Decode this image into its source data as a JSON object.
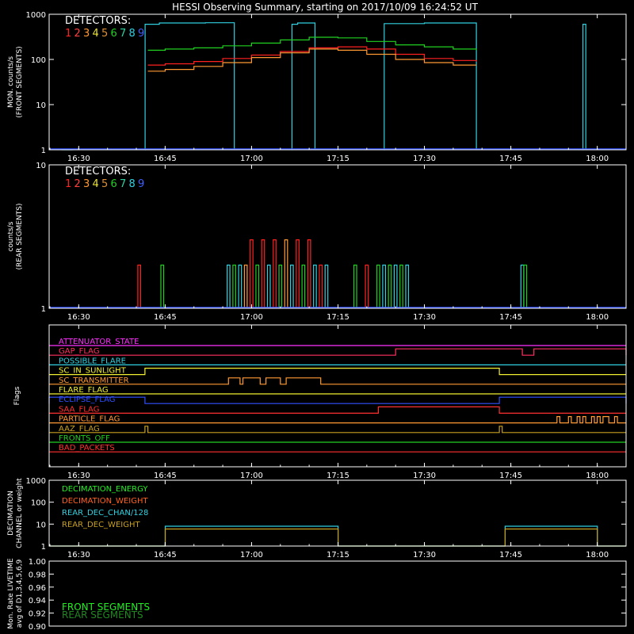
{
  "title": "HESSI Observing Summary, starting on 2017/10/09 16:24:52 UT",
  "colors": {
    "background": "#000000",
    "axis": "#ffffff",
    "det": [
      "#ff2020",
      "#ff4040",
      "#ff9933",
      "#e8e030",
      "#e09030",
      "#20d020",
      "#30d0a0",
      "#30d0e0",
      "#4060ff"
    ],
    "front": "#20ee20",
    "rear": "#208820"
  },
  "chart_data": [
    {
      "type": "line",
      "panel": "front",
      "ylabel": [
        "MON. counts/s",
        "(FRONT SEGMENTS)"
      ],
      "yscale": "log",
      "ylim": [
        1,
        1000
      ],
      "ytick_labels": [
        "1000",
        "100",
        "10",
        "1"
      ],
      "ytick_values": [
        1000,
        100,
        10,
        1
      ],
      "xlim": [
        "16:24:52",
        "18:05:00"
      ],
      "xtick_labels": [
        "16:30",
        "16:45",
        "17:00",
        "17:15",
        "17:30",
        "17:45",
        "18:00"
      ],
      "legend_title": "DETECTORS:",
      "legend_items": [
        "1",
        "2",
        "3",
        "4",
        "5",
        "6",
        "7",
        "8",
        "9"
      ],
      "series": [
        {
          "color": "#30d0e0",
          "segments": [
            {
              "x": [
                "16:27:00",
                "16:28:30",
                "16:29:00",
                "16:29:01"
              ],
              "y": [
                1,
                1,
                1,
                1
              ]
            },
            {
              "x": [
                "16:41:30",
                "16:41:31",
                "16:44:00",
                "16:52:00",
                "16:56:00",
                "16:57:00",
                "16:57:01"
              ],
              "y": [
                1,
                600,
                640,
                650,
                650,
                650,
                1
              ]
            },
            {
              "x": [
                "17:07:00",
                "17:07:01",
                "17:08:00",
                "17:11:00",
                "17:11:01"
              ],
              "y": [
                1,
                600,
                640,
                640,
                1
              ]
            },
            {
              "x": [
                "17:23:00",
                "17:23:01",
                "17:30:00",
                "17:35:00",
                "17:39:00",
                "17:39:01"
              ],
              "y": [
                1,
                620,
                640,
                640,
                640,
                1
              ]
            },
            {
              "x": [
                "17:57:30",
                "17:57:31",
                "17:58:00",
                "17:58:01"
              ],
              "y": [
                1,
                600,
                600,
                1
              ]
            }
          ]
        },
        {
          "color": "#20d020",
          "segments": [
            {
              "x": [
                "16:42:00",
                "16:45:00",
                "16:50:00",
                "16:55:00",
                "17:00:00",
                "17:05:00",
                "17:10:00",
                "17:15:00",
                "17:20:00",
                "17:25:00",
                "17:30:00",
                "17:35:00",
                "17:39:00"
              ],
              "y": [
                160,
                170,
                180,
                200,
                230,
                270,
                310,
                300,
                250,
                210,
                190,
                170,
                160
              ]
            }
          ]
        },
        {
          "color": "#ff2020",
          "segments": [
            {
              "x": [
                "16:42:00",
                "16:45:00",
                "16:50:00",
                "16:55:00",
                "17:00:00",
                "17:05:00",
                "17:10:00",
                "17:15:00",
                "17:20:00",
                "17:25:00",
                "17:30:00",
                "17:35:00",
                "17:39:00"
              ],
              "y": [
                75,
                80,
                90,
                105,
                125,
                150,
                180,
                190,
                170,
                130,
                105,
                95,
                90
              ]
            }
          ]
        },
        {
          "color": "#ff9933",
          "segments": [
            {
              "x": [
                "16:42:00",
                "16:45:00",
                "16:50:00",
                "16:55:00",
                "17:00:00",
                "17:05:00",
                "17:10:00",
                "17:15:00",
                "17:20:00",
                "17:25:00",
                "17:30:00",
                "17:35:00",
                "17:39:00"
              ],
              "y": [
                55,
                60,
                70,
                85,
                110,
                140,
                170,
                160,
                130,
                100,
                85,
                75,
                75
              ]
            }
          ]
        }
      ]
    },
    {
      "type": "line",
      "panel": "rear",
      "ylabel": [
        "counts/s",
        "(REAR SEGMENTS)"
      ],
      "yscale": "log",
      "ylim": [
        1,
        10
      ],
      "ytick_labels": [
        "10",
        "1"
      ],
      "ytick_values": [
        10,
        1
      ],
      "xtick_labels": [
        "16:30",
        "16:45",
        "17:00",
        "17:15",
        "17:30",
        "17:45",
        "18:00"
      ],
      "legend_title": "DETECTORS:",
      "legend_items": [
        "1",
        "2",
        "3",
        "4",
        "5",
        "6",
        "7",
        "8",
        "9"
      ],
      "spikes": [
        {
          "x": "16:40:30",
          "y": 2,
          "color": "#ff2020"
        },
        {
          "x": "16:44:30",
          "y": 2,
          "color": "#20d020"
        },
        {
          "x": "16:56:00",
          "y": 2,
          "color": "#30d0e0"
        },
        {
          "x": "16:57:00",
          "y": 2,
          "color": "#20d020"
        },
        {
          "x": "16:58:00",
          "y": 2,
          "color": "#30d0e0"
        },
        {
          "x": "16:59:00",
          "y": 2,
          "color": "#ff9933"
        },
        {
          "x": "17:00:00",
          "y": 3,
          "color": "#ff2020"
        },
        {
          "x": "17:01:00",
          "y": 2,
          "color": "#20d020"
        },
        {
          "x": "17:02:00",
          "y": 3,
          "color": "#ff2020"
        },
        {
          "x": "17:03:00",
          "y": 2,
          "color": "#30d0e0"
        },
        {
          "x": "17:04:00",
          "y": 3,
          "color": "#ff2020"
        },
        {
          "x": "17:05:00",
          "y": 2,
          "color": "#20d020"
        },
        {
          "x": "17:06:00",
          "y": 3,
          "color": "#ff9933"
        },
        {
          "x": "17:07:00",
          "y": 2,
          "color": "#30d0e0"
        },
        {
          "x": "17:08:00",
          "y": 3,
          "color": "#ff2020"
        },
        {
          "x": "17:09:00",
          "y": 2,
          "color": "#20d020"
        },
        {
          "x": "17:10:00",
          "y": 3,
          "color": "#ff2020"
        },
        {
          "x": "17:11:00",
          "y": 2,
          "color": "#30d0e0"
        },
        {
          "x": "17:12:00",
          "y": 2,
          "color": "#ff2020"
        },
        {
          "x": "17:13:00",
          "y": 2,
          "color": "#30d0e0"
        },
        {
          "x": "17:18:00",
          "y": 2,
          "color": "#20d020"
        },
        {
          "x": "17:20:00",
          "y": 2,
          "color": "#ff2020"
        },
        {
          "x": "17:22:00",
          "y": 2,
          "color": "#20d020"
        },
        {
          "x": "17:23:00",
          "y": 2,
          "color": "#30d0e0"
        },
        {
          "x": "17:24:00",
          "y": 2,
          "color": "#20d020"
        },
        {
          "x": "17:25:00",
          "y": 2,
          "color": "#30d0e0"
        },
        {
          "x": "17:26:00",
          "y": 2,
          "color": "#20d020"
        },
        {
          "x": "17:27:00",
          "y": 2,
          "color": "#30d0e0"
        },
        {
          "x": "17:47:00",
          "y": 2,
          "color": "#30d0e0"
        },
        {
          "x": "17:47:30",
          "y": 2,
          "color": "#20d020"
        }
      ]
    },
    {
      "type": "line",
      "panel": "flags",
      "ylabel": [
        "Flags"
      ],
      "xtick_labels": [
        "16:30",
        "16:45",
        "17:00",
        "17:15",
        "17:30",
        "17:45",
        "18:00"
      ],
      "flags": [
        {
          "name": "ATTENUATOR_STATE",
          "color": "#ff30ff",
          "high": []
        },
        {
          "name": "GAP_FLAG",
          "color": "#ff3060",
          "high": [
            [
              "17:25:00",
              "17:47:00"
            ],
            [
              "17:49:00",
              "18:05:00"
            ]
          ]
        },
        {
          "name": "POSSIBLE_FLARE",
          "color": "#30d0e0",
          "high": []
        },
        {
          "name": "SC_IN_SUNLIGHT",
          "color": "#f0f030",
          "high": [
            [
              "16:41:30",
              "17:43:00"
            ]
          ]
        },
        {
          "name": "SC_TRANSMITTER",
          "color": "#ff9933",
          "high": [
            [
              "16:56:00",
              "16:58:00"
            ],
            [
              "16:58:30",
              "17:01:30"
            ],
            [
              "17:02:30",
              "17:05:00"
            ],
            [
              "17:06:00",
              "17:12:00"
            ]
          ]
        },
        {
          "name": "FLARE_FLAG",
          "color": "#f0f030",
          "high": []
        },
        {
          "name": "ECLIPSE_FLAG",
          "color": "#3050ff",
          "high": [
            [
              "16:24:52",
              "16:41:30"
            ],
            [
              "17:43:00",
              "18:05:00"
            ]
          ]
        },
        {
          "name": "SAA_FLAG",
          "color": "#ff3030",
          "high": [
            [
              "17:22:00",
              "17:43:00"
            ]
          ]
        },
        {
          "name": "PARTICLE_FLAG",
          "color": "#ff9933",
          "high": [
            [
              "17:53:00",
              "17:53:30"
            ],
            [
              "17:55:00",
              "17:55:30"
            ],
            [
              "17:56:30",
              "17:57:00"
            ],
            [
              "17:57:30",
              "17:58:00"
            ],
            [
              "17:59:00",
              "17:59:30"
            ],
            [
              "18:00:00",
              "18:00:30"
            ],
            [
              "18:01:00",
              "18:02:00"
            ],
            [
              "18:03:00",
              "18:03:30"
            ]
          ]
        },
        {
          "name": "AAZ_FLAG",
          "color": "#c8a020",
          "high": [
            [
              "16:41:30",
              "16:42:00"
            ],
            [
              "17:43:00",
              "17:43:30"
            ]
          ]
        },
        {
          "name": "FRONTS_OFF",
          "color": "#20d020",
          "high": []
        },
        {
          "name": "BAD_PACKETS",
          "color": "#ff3030",
          "high": []
        }
      ]
    },
    {
      "type": "line",
      "panel": "decimation",
      "ylabel": [
        "DECIMATION",
        "CHANNEL or weight"
      ],
      "yscale": "log",
      "ylim": [
        1,
        1000
      ],
      "ytick_labels": [
        "1000",
        "100",
        "10",
        "1"
      ],
      "ytick_values": [
        1000,
        100,
        10,
        1
      ],
      "xtick_labels": [
        "16:30",
        "16:45",
        "17:00",
        "17:15",
        "17:30",
        "17:45",
        "18:00"
      ],
      "legend": [
        {
          "label": "DECIMATION_ENERGY",
          "color": "#20ee20"
        },
        {
          "label": "DECIMATION_WEIGHT",
          "color": "#ff6020"
        },
        {
          "label": "REAR_DEC_CHAN/128",
          "color": "#30d0e0"
        },
        {
          "label": "REAR_DEC_WEIGHT",
          "color": "#c8a020"
        }
      ],
      "series": [
        {
          "color": "#30d0e0",
          "x": [
            "16:24:52",
            "16:45:00",
            "16:45:01",
            "17:15:00",
            "17:15:01",
            "17:44:00",
            "17:44:01",
            "18:00:00",
            "18:00:01",
            "18:05:00"
          ],
          "y": [
            1,
            1,
            8,
            8,
            1,
            1,
            8,
            8,
            1,
            1
          ]
        },
        {
          "color": "#c8a020",
          "x": [
            "16:24:52",
            "16:45:00",
            "16:45:01",
            "17:15:00",
            "17:15:01",
            "17:44:00",
            "17:44:01",
            "18:00:00",
            "18:00:01",
            "18:05:00"
          ],
          "y": [
            1,
            1,
            6,
            6,
            1,
            1,
            6,
            6,
            1,
            1
          ]
        }
      ]
    },
    {
      "type": "line",
      "panel": "livetime",
      "ylabel": [
        "Mon. Rate LIVETIME",
        "avg of D1,3,4,5,6,9"
      ],
      "ylim": [
        0.9,
        1.0
      ],
      "ytick_labels": [
        "1.00",
        "0.98",
        "0.96",
        "0.94",
        "0.92",
        "0.90"
      ],
      "ytick_values": [
        1.0,
        0.98,
        0.96,
        0.94,
        0.92,
        0.9
      ],
      "legend": [
        {
          "label": "FRONT SEGMENTS",
          "color": "#20ee20"
        },
        {
          "label": "REAR SEGMENTS",
          "color": "#208820"
        }
      ]
    }
  ]
}
